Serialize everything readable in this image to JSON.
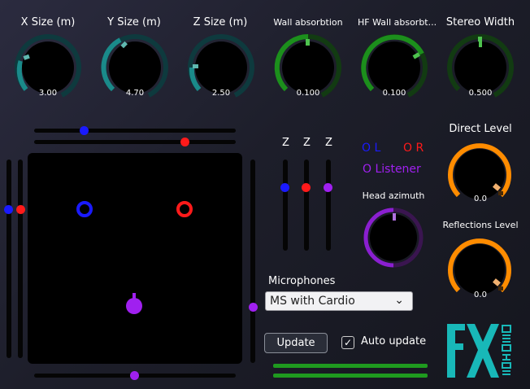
{
  "knobs": {
    "x_size": {
      "label": "X Size (m)",
      "value": "3.00",
      "color": "#1a8a8a",
      "level": 0.12
    },
    "y_size": {
      "label": "Y Size (m)",
      "value": "4.70",
      "color": "#1a8a8a",
      "level": 0.22
    },
    "z_size": {
      "label": "Z Size (m)",
      "value": "2.50",
      "color": "#1a8a8a",
      "level": 0.1
    },
    "wall_absorption": {
      "label": "Wall absorbtion",
      "value": "0.100",
      "color": "#1c8f1c",
      "level": 0.5
    },
    "hf_wall_absorption": {
      "label": "HF Wall absorbt...",
      "value": "0.100",
      "color": "#1c8f1c",
      "level": 0.68
    },
    "stereo_width": {
      "label": "Stereo Width",
      "value": "0.500",
      "color": "#1c8f1c",
      "level": 0.5
    }
  },
  "levels": {
    "direct": {
      "label": "Direct Level",
      "value": "0.0",
      "color": "#ff8c00"
    },
    "reflections": {
      "label": "Reflections Level",
      "value": "0.0",
      "color": "#ff8c00"
    }
  },
  "head_azimuth": {
    "label": "Head azimuth",
    "color": "#8a1fd0"
  },
  "legend": {
    "left": "O L",
    "right": "O R",
    "listener": "O Listener",
    "left_color": "#1a1aff",
    "right_color": "#ff1a1a",
    "listener_color": "#a020f0"
  },
  "z_sliders": {
    "labels": [
      "Z",
      "Z",
      "Z"
    ]
  },
  "microphones": {
    "label": "Microphones",
    "selected": "MS with Cardio"
  },
  "update_button": "Update",
  "auto_update": {
    "label": "Auto update",
    "checked": true
  },
  "logo": {
    "brand_color": "#18b8b8"
  }
}
